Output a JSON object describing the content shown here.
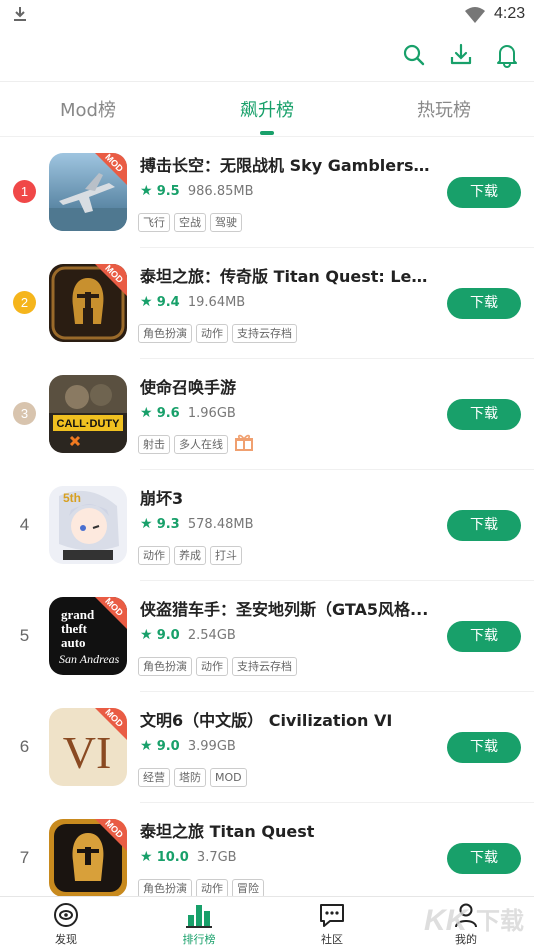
{
  "status_bar": {
    "time": "4:23"
  },
  "tabs": [
    {
      "label": "Mod榜"
    },
    {
      "label": "飙升榜"
    },
    {
      "label": "热玩榜"
    }
  ],
  "badge_label": "MOD",
  "download_label": "下载",
  "apps": [
    {
      "rank": "1",
      "title": "搏击长空：无限战机 Sky Gamblers - I...",
      "score": "9.5",
      "size": "986.85MB",
      "tags": [
        "飞行",
        "空战",
        "驾驶"
      ]
    },
    {
      "rank": "2",
      "title": "泰坦之旅：传奇版 Titan Quest: Legen...",
      "score": "9.4",
      "size": "19.64MB",
      "tags": [
        "角色扮演",
        "动作",
        "支持云存档"
      ]
    },
    {
      "rank": "3",
      "title": "使命召唤手游",
      "score": "9.6",
      "size": "1.96GB",
      "tags": [
        "射击",
        "多人在线"
      ]
    },
    {
      "rank": "4",
      "title": "崩坏3",
      "score": "9.3",
      "size": "578.48MB",
      "tags": [
        "动作",
        "养成",
        "打斗"
      ]
    },
    {
      "rank": "5",
      "title": "侠盗猎车手：圣安地列斯（GTA5风格...",
      "score": "9.0",
      "size": "2.54GB",
      "tags": [
        "角色扮演",
        "动作",
        "支持云存档"
      ]
    },
    {
      "rank": "6",
      "title": "文明6（中文版） Civilization VI",
      "score": "9.0",
      "size": "3.99GB",
      "tags": [
        "经营",
        "塔防",
        "MOD"
      ]
    },
    {
      "rank": "7",
      "title": "泰坦之旅 Titan Quest",
      "score": "10.0",
      "size": "3.7GB",
      "tags": [
        "角色扮演",
        "动作",
        "冒险"
      ]
    }
  ],
  "bottom_nav": [
    {
      "label": "发现"
    },
    {
      "label": "排行榜"
    },
    {
      "label": "社区"
    },
    {
      "label": "我的"
    }
  ],
  "icons": {
    "status": [
      "download-notification-icon",
      "wifi-icon"
    ],
    "action_bar": [
      "search-icon",
      "download-icon",
      "bell-icon"
    ]
  },
  "colors": {
    "accent": "#18a06a",
    "rank_1": "#f04848",
    "rank_2": "#f5b51c",
    "rank_3": "#d8c4ae",
    "mod_badge": "#e95c44"
  }
}
